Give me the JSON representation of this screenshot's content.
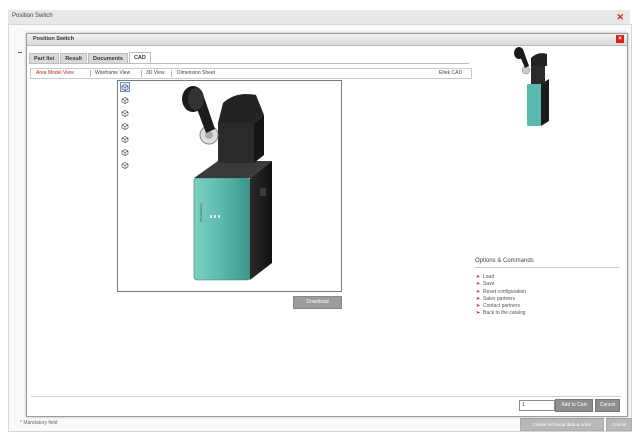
{
  "window": {
    "title": "Position Switch",
    "dialog_title": "Position Switch",
    "mandatory_note": "* Mandatory field"
  },
  "tabs": [
    {
      "label": "Part list"
    },
    {
      "label": "Result"
    },
    {
      "label": "Documents"
    },
    {
      "label": "CAD"
    }
  ],
  "views": {
    "area_model": "Area Model View",
    "wireframe": "Wireframe View",
    "view_3d": "3D View",
    "dimension": "Dimension Sheet",
    "brand": "Eltek CAD"
  },
  "actions": {
    "download": "Download",
    "add_to_cart": "Add to Cart",
    "cancel": "Cancel",
    "qty": "1",
    "create_request": "Create technical data & order",
    "cancel_outer": "Cancel"
  },
  "options": {
    "heading": "Options & Commands",
    "items": [
      "Load",
      "Save",
      "Reset configuration",
      "Sales partners",
      "Contact partners",
      "Back to the catalog"
    ]
  },
  "colors": {
    "accent_red": "#c02020",
    "switch_body": "#5ab8ad",
    "switch_dark": "#1e1e1e"
  }
}
